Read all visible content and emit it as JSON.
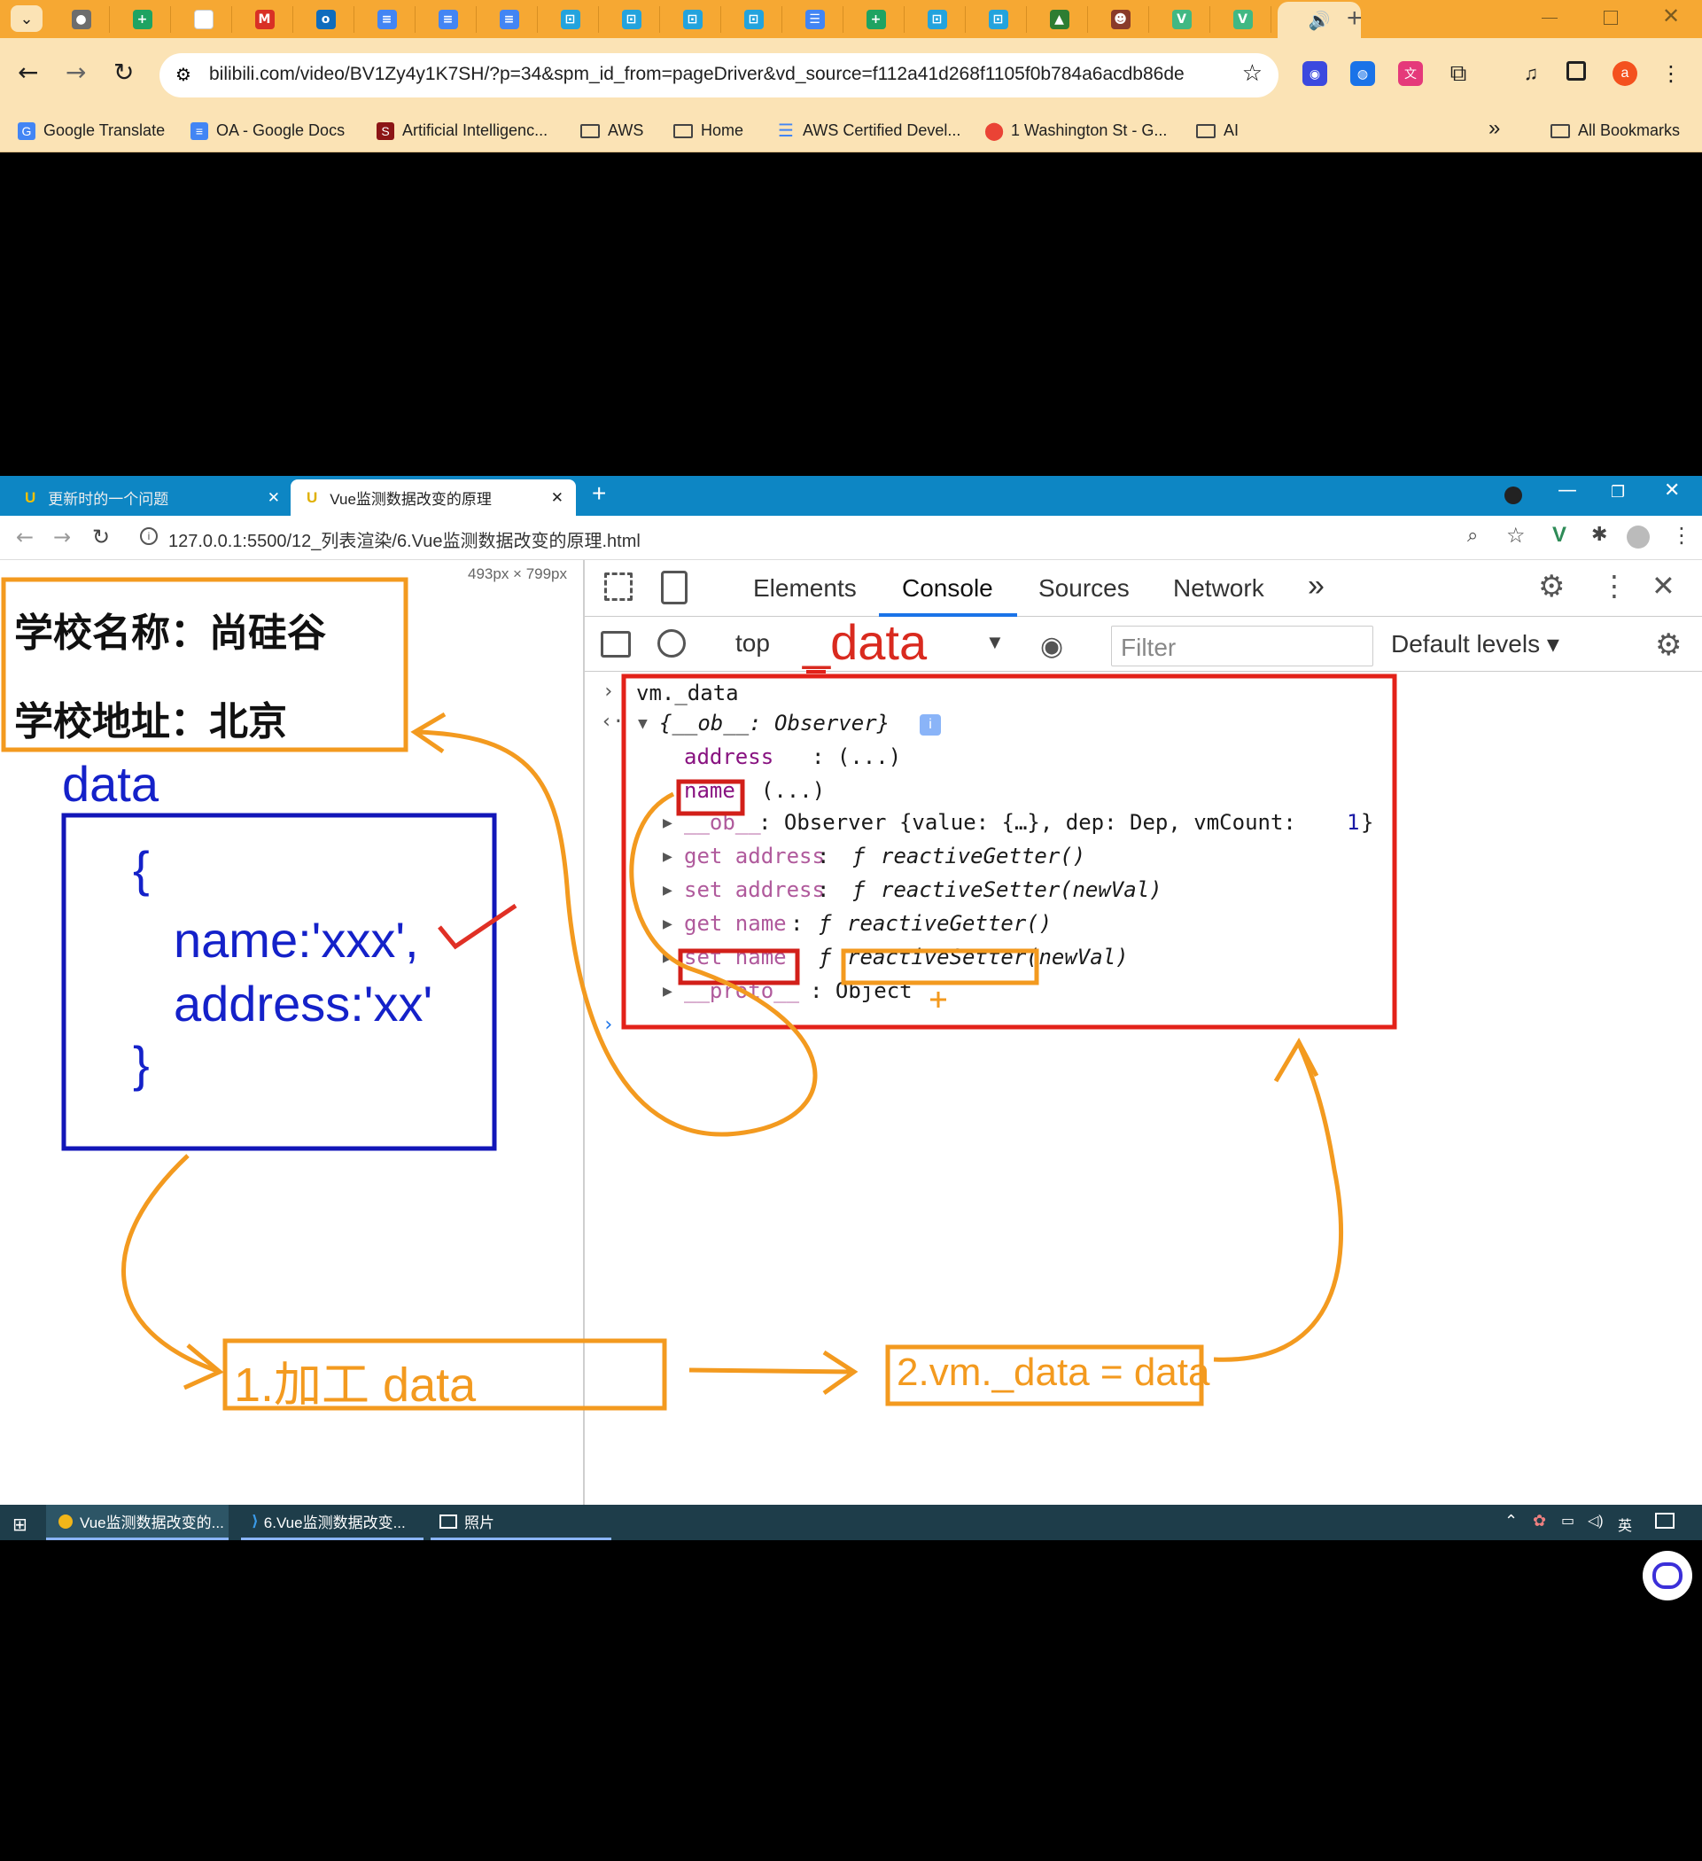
{
  "outer_browser": {
    "tabs": [
      {
        "icon": "chrome-icon",
        "color": "#6d6d6d",
        "glyph": "●"
      },
      {
        "icon": "sheets-icon",
        "color": "#1ea362",
        "glyph": "+"
      },
      {
        "icon": "blank-doc-icon",
        "color": "#ffffff",
        "glyph": ""
      },
      {
        "icon": "gmail-icon",
        "color": "#d93025",
        "glyph": "M"
      },
      {
        "icon": "outlook-icon",
        "color": "#0f6cbd",
        "glyph": "o"
      },
      {
        "icon": "docs-icon",
        "color": "#4285f4",
        "glyph": "≡"
      },
      {
        "icon": "docs-icon",
        "color": "#4285f4",
        "glyph": "≡"
      },
      {
        "icon": "docs-icon",
        "color": "#4285f4",
        "glyph": "≡"
      },
      {
        "icon": "bilibili-icon",
        "color": "#23a3dd",
        "glyph": "⊡"
      },
      {
        "icon": "bilibili-icon",
        "color": "#23a3dd",
        "glyph": "⊡"
      },
      {
        "icon": "bilibili-icon",
        "color": "#23a3dd",
        "glyph": "⊡"
      },
      {
        "icon": "bilibili-icon",
        "color": "#23a3dd",
        "glyph": "⊡"
      },
      {
        "icon": "list-icon",
        "color": "#4285f4",
        "glyph": "☰"
      },
      {
        "icon": "sheets-icon",
        "color": "#1ea362",
        "glyph": "+"
      },
      {
        "icon": "bilibili-icon",
        "color": "#23a3dd",
        "glyph": "⊡"
      },
      {
        "icon": "bilibili-icon",
        "color": "#23a3dd",
        "glyph": "⊡"
      },
      {
        "icon": "mountain-icon",
        "color": "#2e7d32",
        "glyph": "▲"
      },
      {
        "icon": "avatar-icon",
        "color": "#8a3b2a",
        "glyph": "☻"
      },
      {
        "icon": "vue-icon",
        "color": "#41b883",
        "glyph": "V"
      },
      {
        "icon": "vue-icon",
        "color": "#41b883",
        "glyph": "V"
      }
    ],
    "active_tab_icon": "speaker-icon",
    "new_tab": "+",
    "url": "bilibili.com/video/BV1Zy4y1K7SH/?p=34&spm_id_from=pageDriver&vd_source=f112a41d268f1105f0b784a6acdb86de",
    "profile_initial": "a",
    "bookmarks": [
      {
        "label": "Google Translate",
        "icon": "translate-icon"
      },
      {
        "label": "OA - Google Docs",
        "icon": "docs-icon"
      },
      {
        "label": "Artificial Intelligenc...",
        "icon": "stanford-icon"
      },
      {
        "label": "AWS",
        "icon": "folder-icon"
      },
      {
        "label": "Home",
        "icon": "folder-icon"
      },
      {
        "label": "AWS Certified Devel...",
        "icon": "list-icon"
      },
      {
        "label": "1 Washington St - G...",
        "icon": "maps-pin-icon"
      },
      {
        "label": "AI",
        "icon": "folder-icon"
      }
    ],
    "bookmarks_overflow": "»",
    "all_bookmarks": "All Bookmarks"
  },
  "inner_browser": {
    "tabs": [
      {
        "label": "更新时的一个问题",
        "active": false
      },
      {
        "label": "Vue监测数据改变的原理",
        "active": true
      }
    ],
    "new_tab": "+",
    "url": "127.0.0.1:5500/12_列表渲染/6.Vue监测数据改变的原理.html",
    "viewport_size": "493px × 799px"
  },
  "page_content": {
    "school_name": "学校名称：尚硅谷",
    "school_address": "学校地址：北京"
  },
  "devtools": {
    "tabs": [
      "Elements",
      "Console",
      "Sources",
      "Network"
    ],
    "active_tab": "Console",
    "more_tabs": "»",
    "context": "top",
    "filter_placeholder": "Filter",
    "levels": "Default levels",
    "console": {
      "input": "vm._data",
      "object_summary": "{__ob__: Observer}",
      "address_prop": "address",
      "name_prop": "name",
      "getter_value": ": (...)",
      "ob_line_key": "__ob__",
      "ob_line_value": ": Observer {value: {…}, dep: Dep, vmCount: ",
      "ob_line_count": "1",
      "ob_line_end": "}",
      "get_address": "get address",
      "set_address": "set address",
      "get_name": "get name",
      "set_name": "set name",
      "reactive_getter": "reactiveGetter()",
      "reactive_setter": "reactiveSetter",
      "new_val": "(newVal)",
      "proto_key": "__proto__",
      "proto_value": ": Object",
      "f_symbol": "ƒ"
    }
  },
  "annotations": {
    "data_top": "_data",
    "data_label": "data",
    "code_open": "{",
    "code_name": "name:'xxx',",
    "code_address": "address:'xx'",
    "code_close": "}",
    "step1": "1.加工 data",
    "step2": "2.vm._data = data"
  },
  "taskbar": {
    "items": [
      {
        "label": "Vue监测数据改变的...",
        "icon": "chrome-icon"
      },
      {
        "label": "6.Vue监测数据改变...",
        "icon": "vscode-icon"
      },
      {
        "label": "照片",
        "icon": "photos-icon"
      }
    ],
    "ime": "英"
  }
}
